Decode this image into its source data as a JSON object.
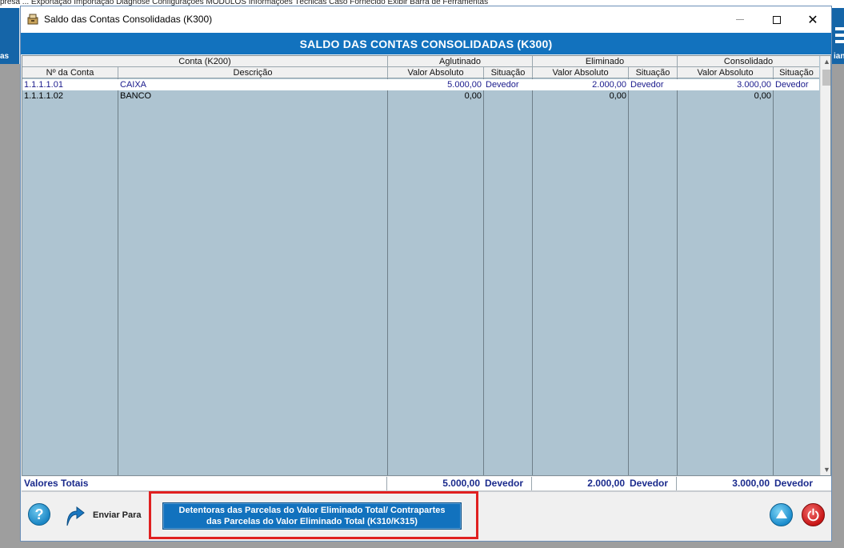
{
  "background": {
    "menubar_text": "presa    ...    Exportação  Importação  Diagnose  Configurações  MÓDULOS  Informações Técnicas  Caso Fornecido  Exibir Barra de Ferramentas",
    "left_label": "as",
    "right_label": "ian"
  },
  "window": {
    "title": "Saldo das Contas Consolidadas (K300)",
    "minimize_icon": "minimize-icon",
    "maximize_icon": "maximize-icon",
    "close_icon": "close-icon",
    "close_glyph": "✕"
  },
  "header": {
    "title": "SALDO DAS CONTAS CONSOLIDADAS (K300)"
  },
  "table": {
    "group_headers": {
      "conta": "Conta (K200)",
      "aglutinado": "Aglutinado",
      "eliminado": "Eliminado",
      "consolidado": "Consolidado"
    },
    "columns": {
      "numero": "Nº da Conta",
      "descricao": "Descrição",
      "agl_valor": "Valor Absoluto",
      "agl_sit": "Situação",
      "eli_valor": "Valor Absoluto",
      "eli_sit": "Situação",
      "con_valor": "Valor Absoluto",
      "con_sit": "Situação"
    },
    "rows": [
      {
        "numero": "1.1.1.1.01",
        "descricao": "CAIXA",
        "agl_valor": "5.000,00",
        "agl_sit": "Devedor",
        "eli_valor": "2.000,00",
        "eli_sit": "Devedor",
        "con_valor": "3.000,00",
        "con_sit": "Devedor"
      },
      {
        "numero": "1.1.1.1.02",
        "descricao": "BANCO",
        "agl_valor": "0,00",
        "agl_sit": "",
        "eli_valor": "0,00",
        "eli_sit": "",
        "con_valor": "0,00",
        "con_sit": ""
      }
    ]
  },
  "totals": {
    "label": "Valores Totais",
    "agl_valor": "5.000,00",
    "agl_sit": "Devedor",
    "eli_valor": "2.000,00",
    "eli_sit": "Devedor",
    "con_valor": "3.000,00",
    "con_sit": "Devedor"
  },
  "footer": {
    "help_glyph": "?",
    "help_icon": "help-icon",
    "send_icon": "send-arrow-icon",
    "send_label": "Enviar Para",
    "action_line1": "Detentoras das Parcelas  do Valor Eliminado Total/ Contrapartes",
    "action_line2": "das Parcelas do Valor Eliminado Total (K310/K315)",
    "up_icon": "scroll-up-icon",
    "power_icon": "power-icon"
  },
  "colors": {
    "header_blue": "#1272be",
    "grid_bg": "#aec4d1",
    "total_text": "#1a2a8c",
    "highlight_red": "#e02020"
  }
}
